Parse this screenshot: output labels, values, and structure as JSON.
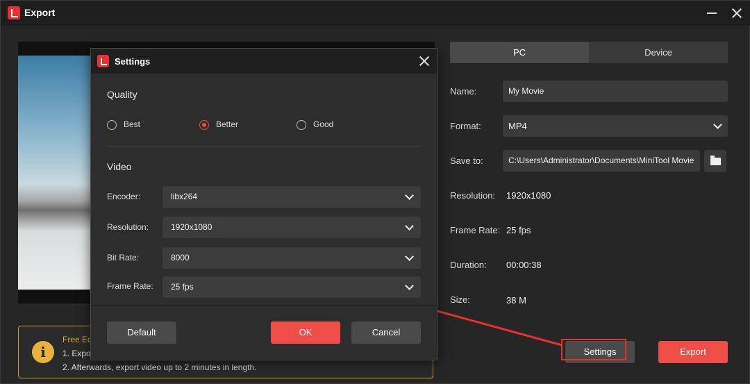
{
  "window": {
    "title": "Export"
  },
  "tabs": [
    {
      "label": "PC"
    },
    {
      "label": "Device"
    }
  ],
  "export_form": {
    "name_label": "Name:",
    "name_value": "My Movie",
    "format_label": "Format:",
    "format_value": "MP4",
    "save_label": "Save to:",
    "save_value": "C:\\Users\\Administrator\\Documents\\MiniTool Movie",
    "resolution_label": "Resolution:",
    "resolution_value": "1920x1080",
    "framerate_label": "Frame Rate:",
    "framerate_value": "25 fps",
    "duration_label": "Duration:",
    "duration_value": "00:00:38",
    "size_label": "Size:",
    "size_value": "38 M"
  },
  "notice": {
    "title": "Free Ed",
    "line1": "1. Expo",
    "line2": "2. Afterwards, export video up to 2 minutes in length."
  },
  "buttons": {
    "settings": "Settings",
    "export": "Export"
  },
  "settings_dialog": {
    "title": "Settings",
    "quality_heading": "Quality",
    "quality_options": [
      "Best",
      "Better",
      "Good"
    ],
    "selected_quality": "Better",
    "video_heading": "Video",
    "encoder_label": "Encoder:",
    "encoder_value": "libx264",
    "resolution_label": "Resolution:",
    "resolution_value": "1920x1080",
    "bitrate_label": "Bit Rate:",
    "bitrate_value": "8000",
    "framerate_label": "Frame Rate:",
    "framerate_value": "25 fps",
    "default_label": "Default",
    "ok_label": "OK",
    "cancel_label": "Cancel"
  },
  "colors": {
    "accent": "#ef4d47",
    "highlight": "#e8322f",
    "notice_border": "#c9a227"
  }
}
